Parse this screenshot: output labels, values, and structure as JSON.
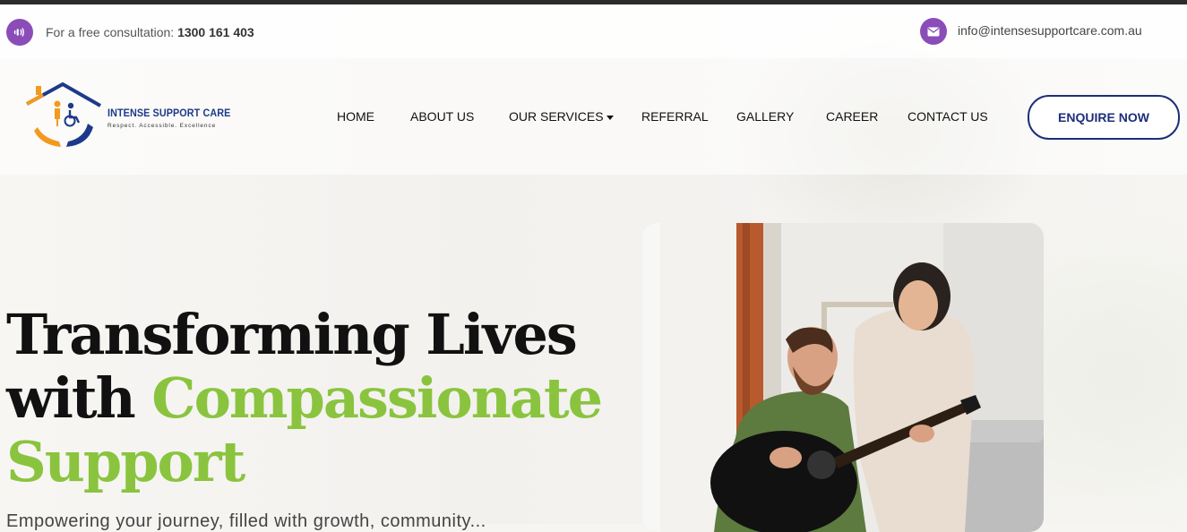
{
  "topbar": {
    "consult_prefix": "For a free consultation:",
    "phone": "1300 161 403",
    "email": "info@intensesupportcare.com.au",
    "phone_icon": "phone-volume-icon",
    "mail_icon": "envelope-icon"
  },
  "logo": {
    "name": "INTENSE SUPPORT CARE",
    "tagline": "Respect. Accessible. Excellence"
  },
  "nav": {
    "items": [
      {
        "label": "HOME"
      },
      {
        "label": "ABOUT US"
      },
      {
        "label": "OUR SERVICES"
      },
      {
        "label": "REFERRAL"
      },
      {
        "label": "GALLERY"
      },
      {
        "label": "CAREER"
      },
      {
        "label": "CONTACT US"
      }
    ],
    "cta": "ENQUIRE NOW"
  },
  "hero": {
    "line1": "Transforming Lives",
    "line2_prefix": "with ",
    "highlight": "Compassionate",
    "highlight2": "Support",
    "subtitle": "Empowering your journey, filled with growth, community..."
  },
  "colors": {
    "accent_purple": "#8a4db8",
    "brand_navy": "#1d2f7a",
    "highlight_green": "#8ac43f",
    "logo_orange": "#f39a1e"
  }
}
